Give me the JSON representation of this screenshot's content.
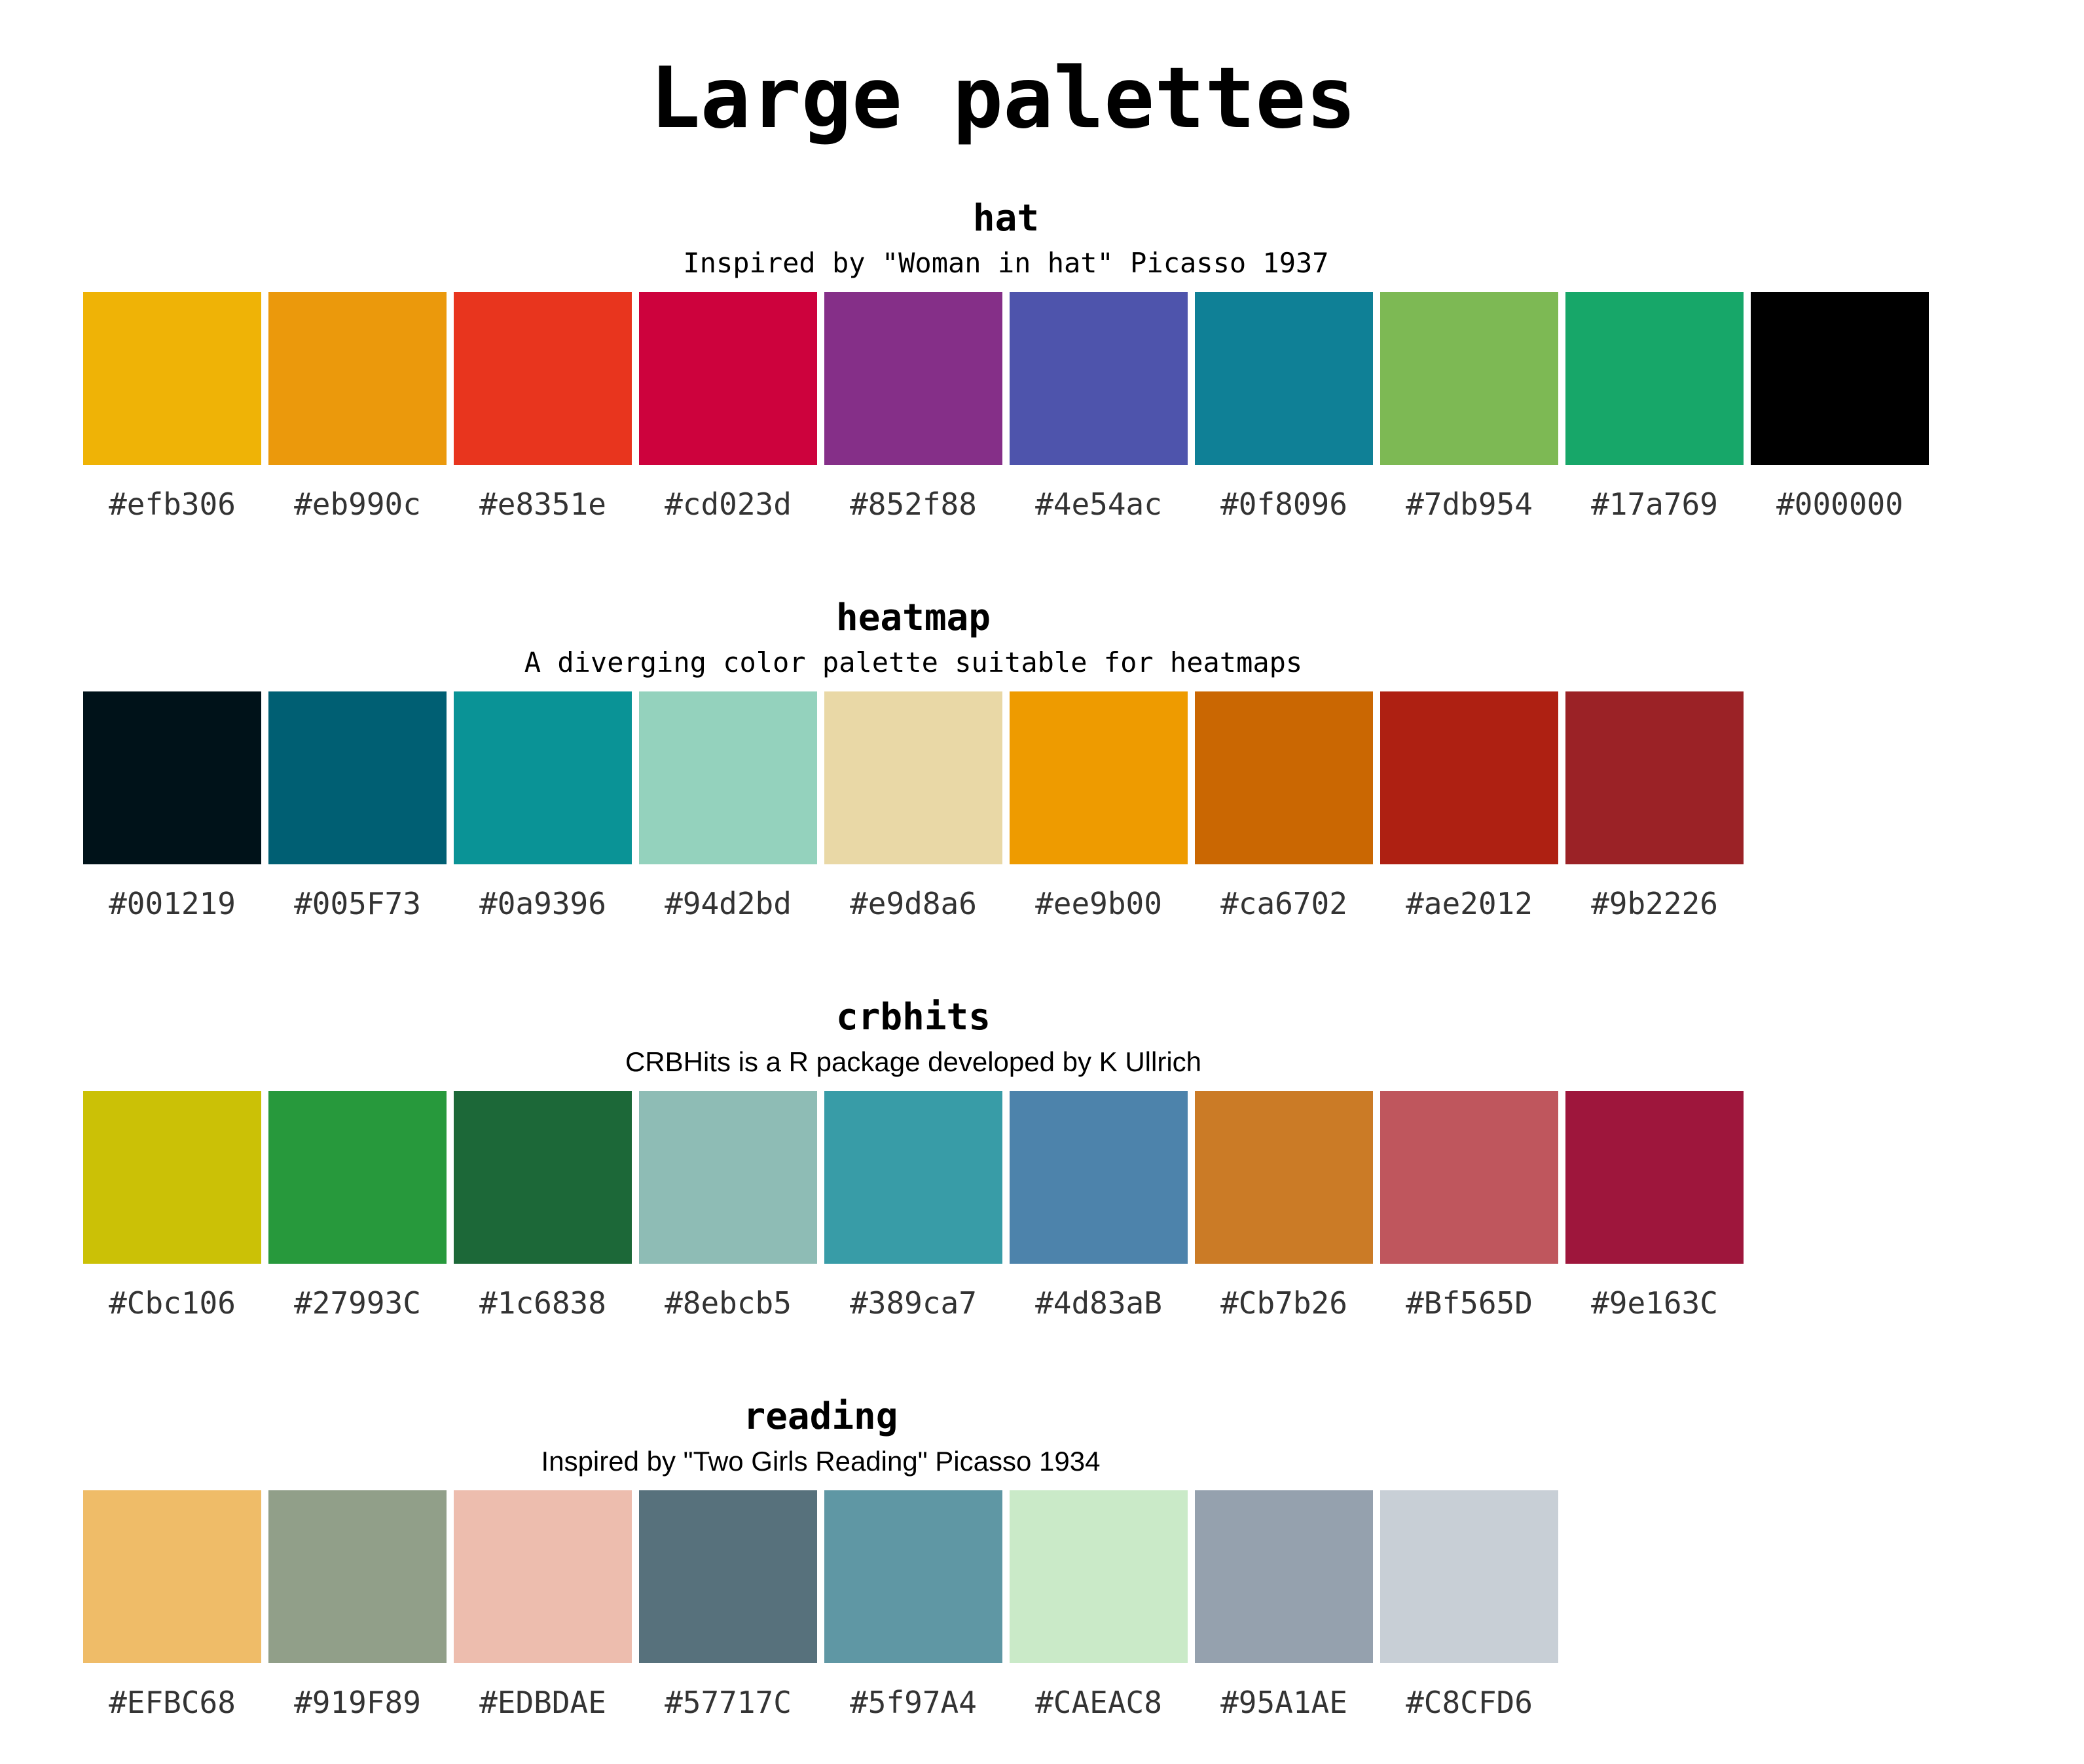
{
  "title": "Large palettes",
  "palettes": [
    {
      "name": "hat",
      "description": "Inspired by \"Woman in hat\" Picasso 1937",
      "colors": [
        "#efb306",
        "#eb990c",
        "#e8351e",
        "#cd023d",
        "#852f88",
        "#4e54ac",
        "#0f8096",
        "#7db954",
        "#17a769",
        "#000000"
      ]
    },
    {
      "name": "heatmap",
      "description": "A diverging color palette suitable for heatmaps",
      "colors": [
        "#001219",
        "#005F73",
        "#0a9396",
        "#94d2bd",
        "#e9d8a6",
        "#ee9b00",
        "#ca6702",
        "#ae2012",
        "#9b2226"
      ]
    },
    {
      "name": "crbhits",
      "description": "CRBHits is a R package developed by K Ullrich",
      "colors": [
        "#Cbc106",
        "#27993C",
        "#1c6838",
        "#8ebcb5",
        "#389ca7",
        "#4d83aB",
        "#Cb7b26",
        "#Bf565D",
        "#9e163C"
      ]
    },
    {
      "name": "reading",
      "description": "Inspired by \"Two Girls Reading\" Picasso 1934",
      "colors": [
        "#EFBC68",
        "#919F89",
        "#EDBDAE",
        "#57717C",
        "#5f97A4",
        "#CAEAC8",
        "#95A1AE",
        "#C8CFD6"
      ]
    }
  ]
}
